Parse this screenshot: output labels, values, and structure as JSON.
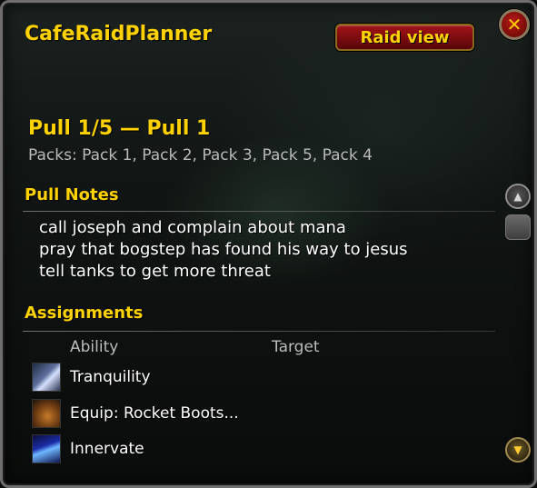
{
  "window": {
    "title": "CafeRaidPlanner",
    "raid_view_label": "Raid view",
    "close_glyph": "✕"
  },
  "pull": {
    "title": "Pull 1/5 — Pull 1",
    "packs": "Packs: Pack 1, Pack 2, Pack 3, Pack 5, Pack 4"
  },
  "notes": {
    "header": "Pull Notes",
    "lines": [
      "call joseph and complain about mana",
      "pray that bogstep has found his way to jesus",
      "tell tanks to get more threat"
    ]
  },
  "assignments": {
    "header": "Assignments",
    "columns": {
      "ability": "Ability",
      "target": "Target"
    },
    "rows": [
      {
        "icon": "tranquility-icon",
        "ability": "Tranquility",
        "target": ""
      },
      {
        "icon": "rocket-boots-icon",
        "ability": "Equip: Rocket Boots...",
        "target": ""
      },
      {
        "icon": "innervate-icon",
        "ability": "Innervate",
        "target": ""
      }
    ]
  },
  "scrollbar": {
    "up_glyph": "▲",
    "down_glyph": "▼"
  },
  "colors": {
    "accent_gold": "#ffd200",
    "button_red": "#a3141a",
    "text_white": "#ffffff",
    "text_gray": "#b9b9b9"
  }
}
